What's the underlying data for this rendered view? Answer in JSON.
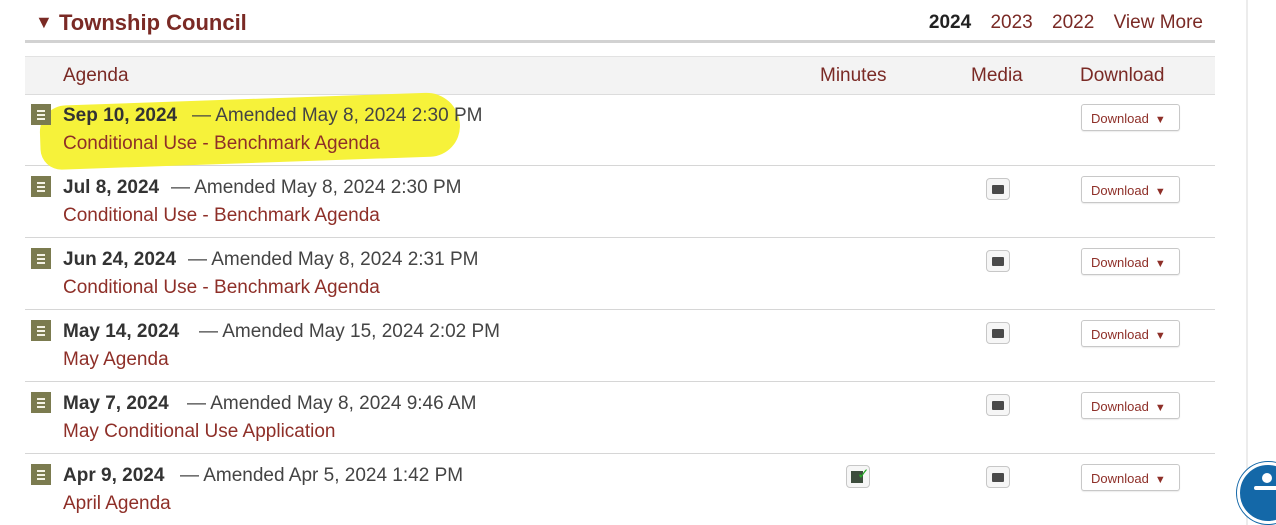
{
  "section": {
    "title": "Township Council",
    "toggle_glyph": "▼"
  },
  "years": {
    "current": "2024",
    "others": [
      "2023",
      "2022"
    ],
    "more": "View More"
  },
  "columns": {
    "agenda": "Agenda",
    "minutes": "Minutes",
    "media": "Media",
    "download": "Download"
  },
  "download_button": {
    "label": "Download",
    "caret": "▼"
  },
  "rows": [
    {
      "date": "Sep 10, 2024",
      "amended": "— Amended May 8, 2024 2:30 PM",
      "title": "Conditional Use - Benchmark Agenda",
      "media": false,
      "minutes": false
    },
    {
      "date": "Jul 8, 2024",
      "amended": "— Amended May 8, 2024 2:30 PM",
      "title": "Conditional Use - Benchmark Agenda",
      "media": true,
      "minutes": false
    },
    {
      "date": "Jun 24, 2024",
      "amended": "— Amended May 8, 2024 2:31 PM",
      "title": "Conditional Use - Benchmark Agenda",
      "media": true,
      "minutes": false
    },
    {
      "date": "May 14, 2024",
      "amended": "— Amended May 15, 2024 2:02 PM",
      "title": "May Agenda",
      "media": true,
      "minutes": false
    },
    {
      "date": "May 7, 2024",
      "amended": "— Amended May 8, 2024 9:46 AM",
      "title": "May Conditional Use Application",
      "media": true,
      "minutes": false
    },
    {
      "date": "Apr 9, 2024",
      "amended": "— Amended Apr 5, 2024 1:42 PM",
      "title": "April Agenda",
      "media": true,
      "minutes": true
    }
  ],
  "highlight_color": "#f6f23a",
  "accent_color": "#7a2a25"
}
